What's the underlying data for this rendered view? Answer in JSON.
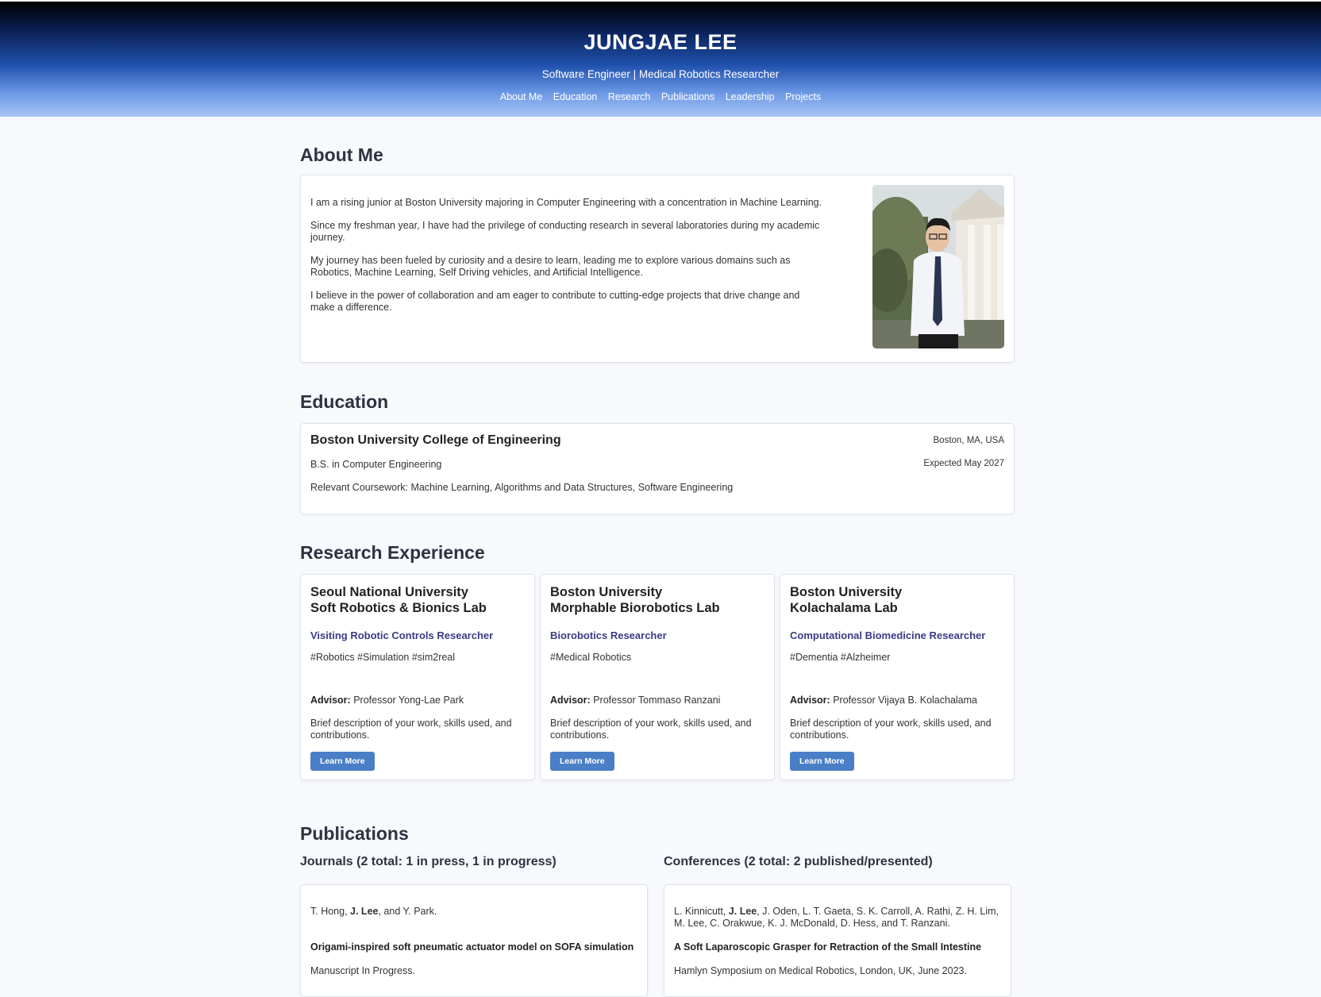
{
  "header": {
    "name": "JUNGJAE LEE",
    "tagline": "Software Engineer | Medical Robotics Researcher",
    "nav": [
      "About Me",
      "Education",
      "Research",
      "Publications",
      "Leadership",
      "Projects"
    ]
  },
  "about": {
    "title": "About Me",
    "paragraphs": [
      "I am a rising junior at Boston University majoring in Computer Engineering with a concentration in Machine Learning.",
      "Since my freshman year, I have had the privilege of conducting research in several laboratories during my academic journey.",
      "My journey has been fueled by curiosity and a desire to learn, leading me to explore various domains such as Robotics, Machine Learning, Self Driving vehicles, and Artificial Intelligence.",
      "I believe in the power of collaboration and am eager to contribute to cutting-edge projects that drive change and make a difference."
    ]
  },
  "education": {
    "title": "Education",
    "school": "Boston University College of Engineering",
    "location": "Boston, MA, USA",
    "degree": "B.S. in Computer Engineering",
    "date": "Expected May 2027",
    "coursework": "Relevant Coursework: Machine Learning, Algorithms and Data Structures, Software Engineering"
  },
  "research": {
    "title": "Research Experience",
    "advisor_label": "Advisor:",
    "button_label": "Learn More",
    "items": [
      {
        "inst1": "Seoul National University",
        "inst2": "Soft Robotics & Bionics Lab",
        "role": "Visiting Robotic Controls Researcher",
        "tags": "#Robotics #Simulation #sim2real",
        "advisor": "Professor Yong-Lae Park",
        "desc": "Brief description of your work, skills used, and contributions."
      },
      {
        "inst1": "Boston University",
        "inst2": "Morphable Biorobotics Lab",
        "role": "Biorobotics Researcher",
        "tags": "#Medical Robotics",
        "advisor": "Professor Tommaso Ranzani",
        "desc": "Brief description of your work, skills used, and contributions."
      },
      {
        "inst1": "Boston University",
        "inst2": "Kolachalama Lab",
        "role": "Computational Biomedicine Researcher",
        "tags": "#Dementia #Alzheimer",
        "advisor": "Professor Vijaya B. Kolachalama",
        "desc": "Brief description of your work, skills used, and contributions."
      }
    ]
  },
  "publications": {
    "title": "Publications",
    "journals_heading": "Journals (2 total: 1 in press, 1 in progress)",
    "conferences_heading": "Conferences (2 total: 2 published/presented)",
    "journal": {
      "authors_pre": "T. Hong, ",
      "authors_bold": "J. Lee",
      "authors_post": ", and Y. Park.",
      "title": "Origami-inspired soft pneumatic actuator model on SOFA simulation",
      "venue": "Manuscript In Progress."
    },
    "conference": {
      "authors_pre": "L. Kinnicutt, ",
      "authors_bold": "J. Lee",
      "authors_post": ", J. Oden, L. T. Gaeta, S. K. Carroll, A. Rathi, Z. H. Lim, M. Lee, C. Orakwue, K. J. McDonald, D. Hess, and T. Ranzani.",
      "title": "A Soft Laparoscopic Grasper for Retraction of the Small Intestine",
      "venue": "Hamlyn Symposium on Medical Robotics, London, UK, June 2023."
    }
  }
}
